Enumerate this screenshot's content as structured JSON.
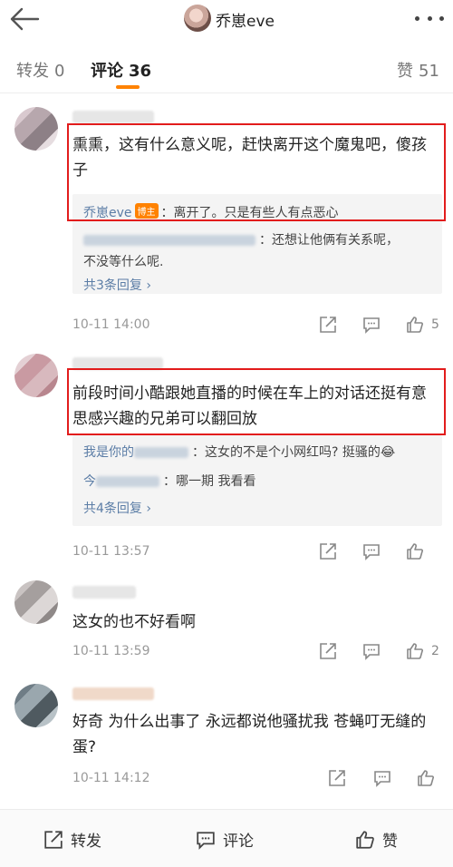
{
  "header": {
    "user_name": "乔崽eve"
  },
  "tabs": [
    {
      "label": "转发",
      "count": "0"
    },
    {
      "label": "评论",
      "count": "36"
    },
    {
      "label": "赞",
      "count": "51"
    }
  ],
  "comments": [
    {
      "text": "熏熏，这有什么意义呢，赶快离开这个魔鬼吧，傻孩子",
      "replies": [
        {
          "author": "乔崽eve",
          "badge": "博主",
          "text": "：离开了。只是有些人有点恶心"
        },
        {
          "author": "",
          "text": "：还想让他俩有关系呢，"
        },
        {
          "author": "",
          "text": "不没等什么呢."
        }
      ],
      "more": "共3条回复 ›",
      "time": "10-11 14:00",
      "likes": "5"
    },
    {
      "text": "前段时间小酷跟她直播的时候在车上的对话还挺有意思感兴趣的兄弟可以翻回放",
      "replies": [
        {
          "author": "我是你的",
          "text": "：这女的不是个小网红吗? 挺骚的😂"
        },
        {
          "author": "今",
          "text": "：哪一期 我看看"
        }
      ],
      "more": "共4条回复 ›",
      "time": "10-11 13:57",
      "likes": ""
    },
    {
      "text": "这女的也不好看啊",
      "time": "10-11 13:59",
      "likes": "2"
    },
    {
      "text": "好奇 为什么出事了 永远都说他骚扰我 苍蝇叮无缝的蛋?",
      "time": "10-11 14:12",
      "likes": ""
    }
  ],
  "bottom": {
    "repost": "转发",
    "comment": "评论",
    "like": "赞"
  },
  "colors": {
    "accent": "#ff8200",
    "link": "#5b7da6",
    "highlight_box": "#e21c1c"
  }
}
